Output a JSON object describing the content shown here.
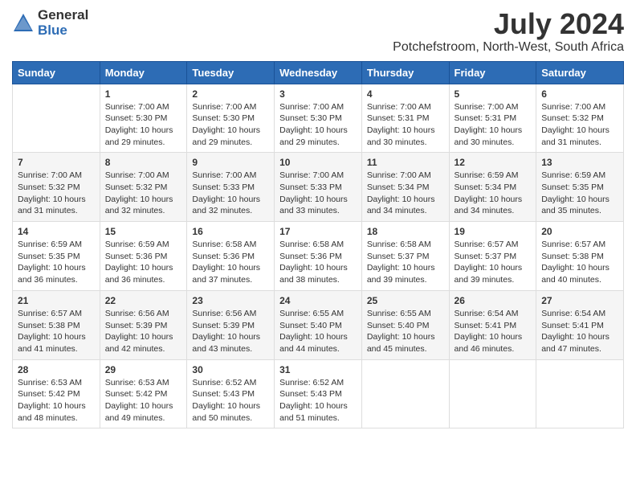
{
  "header": {
    "logo_general": "General",
    "logo_blue": "Blue",
    "month": "July 2024",
    "location": "Potchefstroom, North-West, South Africa"
  },
  "weekdays": [
    "Sunday",
    "Monday",
    "Tuesday",
    "Wednesday",
    "Thursday",
    "Friday",
    "Saturday"
  ],
  "weeks": [
    [
      {
        "day": "",
        "sunrise": "",
        "sunset": "",
        "daylight": ""
      },
      {
        "day": "1",
        "sunrise": "Sunrise: 7:00 AM",
        "sunset": "Sunset: 5:30 PM",
        "daylight": "Daylight: 10 hours and 29 minutes."
      },
      {
        "day": "2",
        "sunrise": "Sunrise: 7:00 AM",
        "sunset": "Sunset: 5:30 PM",
        "daylight": "Daylight: 10 hours and 29 minutes."
      },
      {
        "day": "3",
        "sunrise": "Sunrise: 7:00 AM",
        "sunset": "Sunset: 5:30 PM",
        "daylight": "Daylight: 10 hours and 29 minutes."
      },
      {
        "day": "4",
        "sunrise": "Sunrise: 7:00 AM",
        "sunset": "Sunset: 5:31 PM",
        "daylight": "Daylight: 10 hours and 30 minutes."
      },
      {
        "day": "5",
        "sunrise": "Sunrise: 7:00 AM",
        "sunset": "Sunset: 5:31 PM",
        "daylight": "Daylight: 10 hours and 30 minutes."
      },
      {
        "day": "6",
        "sunrise": "Sunrise: 7:00 AM",
        "sunset": "Sunset: 5:32 PM",
        "daylight": "Daylight: 10 hours and 31 minutes."
      }
    ],
    [
      {
        "day": "7",
        "sunrise": "Sunrise: 7:00 AM",
        "sunset": "Sunset: 5:32 PM",
        "daylight": "Daylight: 10 hours and 31 minutes."
      },
      {
        "day": "8",
        "sunrise": "Sunrise: 7:00 AM",
        "sunset": "Sunset: 5:32 PM",
        "daylight": "Daylight: 10 hours and 32 minutes."
      },
      {
        "day": "9",
        "sunrise": "Sunrise: 7:00 AM",
        "sunset": "Sunset: 5:33 PM",
        "daylight": "Daylight: 10 hours and 32 minutes."
      },
      {
        "day": "10",
        "sunrise": "Sunrise: 7:00 AM",
        "sunset": "Sunset: 5:33 PM",
        "daylight": "Daylight: 10 hours and 33 minutes."
      },
      {
        "day": "11",
        "sunrise": "Sunrise: 7:00 AM",
        "sunset": "Sunset: 5:34 PM",
        "daylight": "Daylight: 10 hours and 34 minutes."
      },
      {
        "day": "12",
        "sunrise": "Sunrise: 6:59 AM",
        "sunset": "Sunset: 5:34 PM",
        "daylight": "Daylight: 10 hours and 34 minutes."
      },
      {
        "day": "13",
        "sunrise": "Sunrise: 6:59 AM",
        "sunset": "Sunset: 5:35 PM",
        "daylight": "Daylight: 10 hours and 35 minutes."
      }
    ],
    [
      {
        "day": "14",
        "sunrise": "Sunrise: 6:59 AM",
        "sunset": "Sunset: 5:35 PM",
        "daylight": "Daylight: 10 hours and 36 minutes."
      },
      {
        "day": "15",
        "sunrise": "Sunrise: 6:59 AM",
        "sunset": "Sunset: 5:36 PM",
        "daylight": "Daylight: 10 hours and 36 minutes."
      },
      {
        "day": "16",
        "sunrise": "Sunrise: 6:58 AM",
        "sunset": "Sunset: 5:36 PM",
        "daylight": "Daylight: 10 hours and 37 minutes."
      },
      {
        "day": "17",
        "sunrise": "Sunrise: 6:58 AM",
        "sunset": "Sunset: 5:36 PM",
        "daylight": "Daylight: 10 hours and 38 minutes."
      },
      {
        "day": "18",
        "sunrise": "Sunrise: 6:58 AM",
        "sunset": "Sunset: 5:37 PM",
        "daylight": "Daylight: 10 hours and 39 minutes."
      },
      {
        "day": "19",
        "sunrise": "Sunrise: 6:57 AM",
        "sunset": "Sunset: 5:37 PM",
        "daylight": "Daylight: 10 hours and 39 minutes."
      },
      {
        "day": "20",
        "sunrise": "Sunrise: 6:57 AM",
        "sunset": "Sunset: 5:38 PM",
        "daylight": "Daylight: 10 hours and 40 minutes."
      }
    ],
    [
      {
        "day": "21",
        "sunrise": "Sunrise: 6:57 AM",
        "sunset": "Sunset: 5:38 PM",
        "daylight": "Daylight: 10 hours and 41 minutes."
      },
      {
        "day": "22",
        "sunrise": "Sunrise: 6:56 AM",
        "sunset": "Sunset: 5:39 PM",
        "daylight": "Daylight: 10 hours and 42 minutes."
      },
      {
        "day": "23",
        "sunrise": "Sunrise: 6:56 AM",
        "sunset": "Sunset: 5:39 PM",
        "daylight": "Daylight: 10 hours and 43 minutes."
      },
      {
        "day": "24",
        "sunrise": "Sunrise: 6:55 AM",
        "sunset": "Sunset: 5:40 PM",
        "daylight": "Daylight: 10 hours and 44 minutes."
      },
      {
        "day": "25",
        "sunrise": "Sunrise: 6:55 AM",
        "sunset": "Sunset: 5:40 PM",
        "daylight": "Daylight: 10 hours and 45 minutes."
      },
      {
        "day": "26",
        "sunrise": "Sunrise: 6:54 AM",
        "sunset": "Sunset: 5:41 PM",
        "daylight": "Daylight: 10 hours and 46 minutes."
      },
      {
        "day": "27",
        "sunrise": "Sunrise: 6:54 AM",
        "sunset": "Sunset: 5:41 PM",
        "daylight": "Daylight: 10 hours and 47 minutes."
      }
    ],
    [
      {
        "day": "28",
        "sunrise": "Sunrise: 6:53 AM",
        "sunset": "Sunset: 5:42 PM",
        "daylight": "Daylight: 10 hours and 48 minutes."
      },
      {
        "day": "29",
        "sunrise": "Sunrise: 6:53 AM",
        "sunset": "Sunset: 5:42 PM",
        "daylight": "Daylight: 10 hours and 49 minutes."
      },
      {
        "day": "30",
        "sunrise": "Sunrise: 6:52 AM",
        "sunset": "Sunset: 5:43 PM",
        "daylight": "Daylight: 10 hours and 50 minutes."
      },
      {
        "day": "31",
        "sunrise": "Sunrise: 6:52 AM",
        "sunset": "Sunset: 5:43 PM",
        "daylight": "Daylight: 10 hours and 51 minutes."
      },
      {
        "day": "",
        "sunrise": "",
        "sunset": "",
        "daylight": ""
      },
      {
        "day": "",
        "sunrise": "",
        "sunset": "",
        "daylight": ""
      },
      {
        "day": "",
        "sunrise": "",
        "sunset": "",
        "daylight": ""
      }
    ]
  ]
}
